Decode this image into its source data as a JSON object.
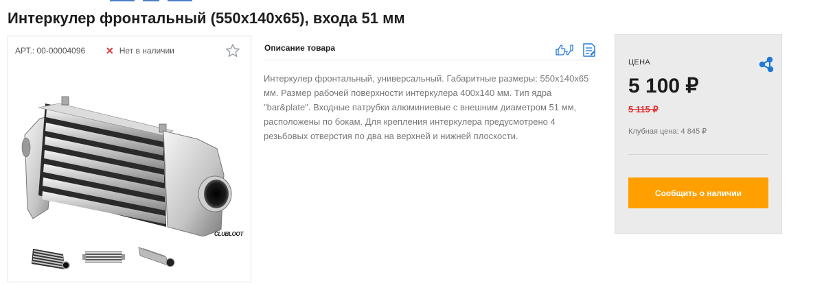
{
  "product": {
    "title": "Интеркулер фронтальный (550х140х65), входа 51 мм",
    "article": "АРТ.: 00-00004096",
    "stock_status": "Нет в наличии",
    "brand_mark": "CLUBLOOT",
    "thumbnails": [
      "front-view",
      "top-view",
      "angle-view"
    ]
  },
  "description": {
    "heading": "Описание товара",
    "text": "Интеркулер фронтальный, универсальный. Габаритные размеры: 550х140х65 мм. Размер рабочей поверхности интеркулера 400х140 мм. Тип ядра \"bar&plate\". Входные патрубки алюминиевые с внешним диаметром 51 мм, расположены по бокам. Для крепления интеркулера предусмотрено 4 резьбовых отверстия по два на верхней и нижней плоскости."
  },
  "price": {
    "label": "ЦЕНА",
    "current": "5 100 ₽",
    "old": "5 115 ₽",
    "club": "Клубная цена: 4 845 ₽"
  },
  "actions": {
    "notify_label": "Сообщить о наличии"
  },
  "icons": {
    "favorite": "star-outline-icon",
    "rate": "thumbs-up-down-icon",
    "notes": "document-edit-icon",
    "share": "share-network-icon"
  },
  "colors": {
    "accent": "#ffa000",
    "old_price": "#e03131",
    "icon_blue": "#1e78d7",
    "panel_bg": "#ebebeb"
  }
}
